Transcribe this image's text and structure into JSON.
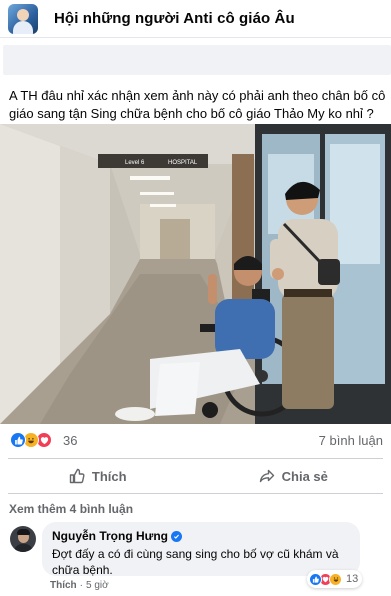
{
  "group": {
    "name": "Hội những người Anti cô giáo Âu"
  },
  "post": {
    "text": "A TH đâu nhỉ xác nhận xem ảnh này có phải anh theo chân bố cô giáo sang tận Sing chữa bệnh cho bố cô giáo Thảo My ko nhỉ ?",
    "photo_sign": "HOSPITAL",
    "photo_sign_level": "Level 6"
  },
  "stats": {
    "reaction_count": "36",
    "comment_count": "7 bình luận"
  },
  "actions": {
    "like_label": "Thích",
    "share_label": "Chia sẻ"
  },
  "comments": {
    "view_more": "Xem thêm 4 bình luận",
    "items": [
      {
        "author": "Nguyễn Trọng Hưng",
        "text": "Đợt đấy a có đi cùng sang sing cho bố vợ cũ khám và chữa bệnh.",
        "like_label": "Thích",
        "time": "5 giờ",
        "reaction_count": "13"
      }
    ]
  },
  "colors": {
    "accent": "#1877f2",
    "text_secondary": "#65676b",
    "bubble": "#f0f2f5"
  },
  "icons": [
    "group-avatar",
    "like-reaction-icon",
    "haha-reaction-icon",
    "love-reaction-icon",
    "thumbs-up-icon",
    "share-arrow-icon",
    "verified-badge-icon"
  ]
}
